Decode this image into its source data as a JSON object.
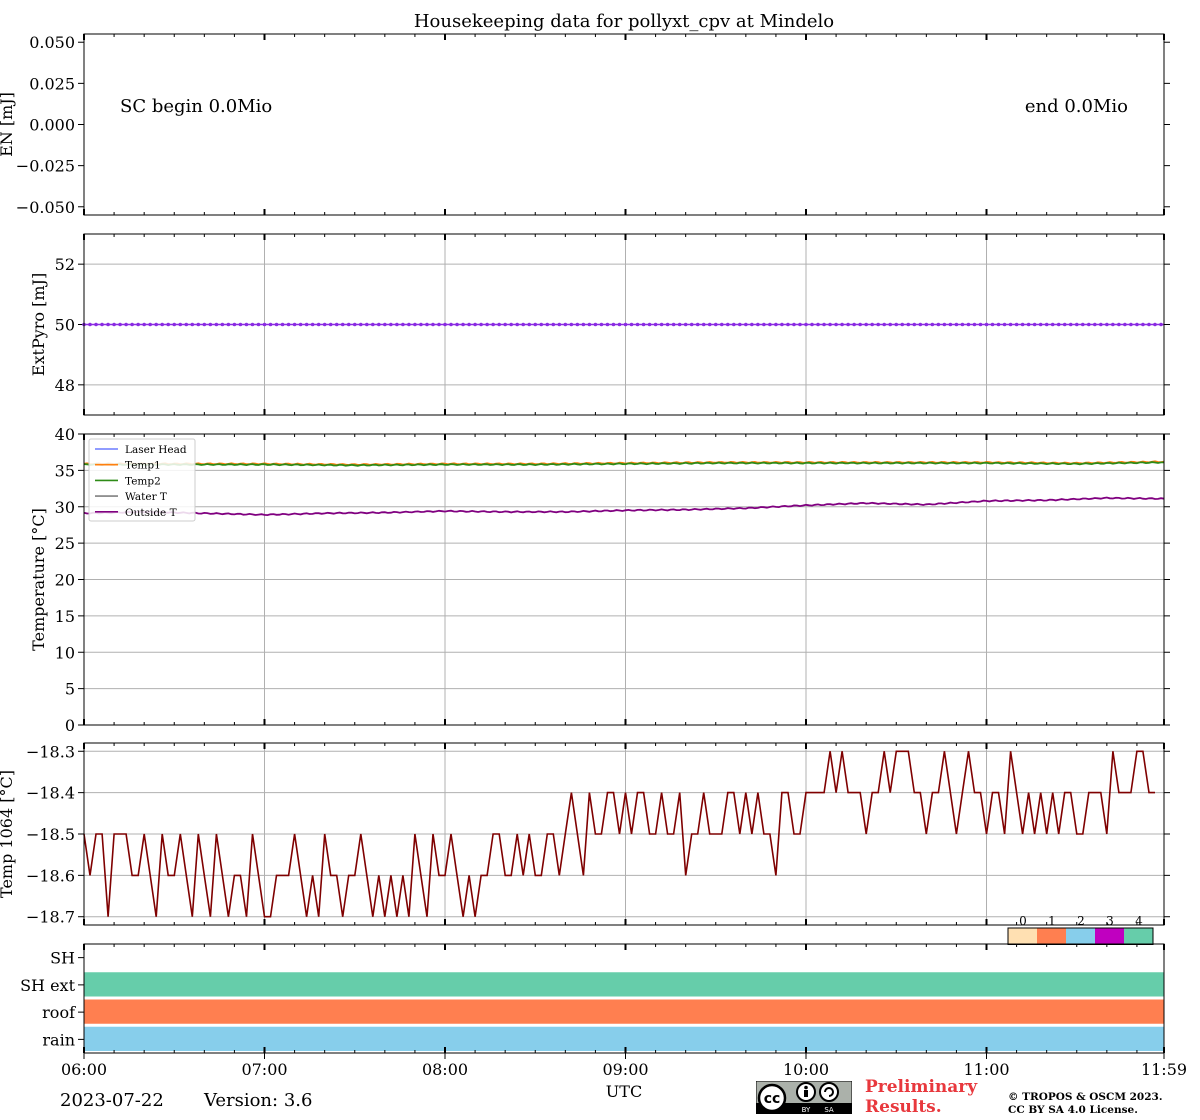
{
  "title": "Housekeeping data for pollyxt_cpv at Mindelo",
  "footer": {
    "date": "2023-07-22",
    "version": "Version: 3.6",
    "preliminary_line1": "Preliminary",
    "preliminary_line2": "Results.",
    "copyright_line1": "© TROPOS & OSCM 2023.",
    "copyright_line2": "CC BY SA 4.0 License.",
    "cc_logo_labels": [
      "cc",
      "BY",
      "SA"
    ]
  },
  "colors": {
    "laser_head": "#6b7bff",
    "temp1": "#ff7f0e",
    "temp2": "#2e8b17",
    "water_t": "#808080",
    "outside_t": "#800080",
    "extpyro": "#8a2be2",
    "temp1064": "#7f0000",
    "flag_0": "#ffe0b2",
    "flag_1": "#ff7f50",
    "flag_2": "#87ceeb",
    "flag_3": "#c000c0",
    "flag_4": "#66cdaa",
    "prelim_red": "#e8383d"
  },
  "chart_data": [
    {
      "type": "line",
      "panel": "energy",
      "ylabel": "EN [mJ]",
      "ylim": [
        -0.055,
        0.055
      ],
      "yticks": [
        "0.050",
        "0.025",
        "0.000",
        "−0.025",
        "−0.050"
      ],
      "ytick_values": [
        0.05,
        0.025,
        0.0,
        -0.025,
        -0.05
      ],
      "annotation_left": "SC begin 0.0Mio",
      "annotation_right": "end 0.0Mio",
      "series": []
    },
    {
      "type": "scatter",
      "panel": "extpyro",
      "ylabel": "ExtPyro [mJ]",
      "ylim": [
        47,
        53
      ],
      "yticks": [
        "52",
        "50",
        "48"
      ],
      "ytick_values": [
        52,
        50,
        48
      ],
      "grid": true,
      "series": [
        {
          "value": 50,
          "x_start": 0,
          "x_end": 359,
          "step": 2
        }
      ]
    },
    {
      "type": "line",
      "panel": "temperature",
      "ylabel": "Temperature [$^\\circ C$]",
      "ylim": [
        0,
        40
      ],
      "yticks": [
        "40",
        "35",
        "30",
        "25",
        "20",
        "15",
        "10",
        "5",
        "0"
      ],
      "ytick_values": [
        40,
        35,
        30,
        25,
        20,
        15,
        10,
        5,
        0
      ],
      "grid": true,
      "legend_position": "upper-left",
      "legend": [
        "Laser Head",
        "Temp1",
        "Temp2",
        "Water T",
        "Outside T"
      ],
      "series": [
        {
          "name": "Temp1",
          "x": [
            0,
            30,
            60,
            90,
            120,
            150,
            180,
            210,
            240,
            270,
            300,
            330,
            359
          ],
          "values": [
            35.9,
            35.9,
            35.9,
            35.8,
            35.9,
            35.9,
            36.0,
            36.1,
            36.1,
            36.1,
            36.1,
            36.0,
            36.2
          ]
        },
        {
          "name": "Temp2",
          "x": [
            0,
            30,
            60,
            90,
            120,
            150,
            180,
            210,
            240,
            270,
            300,
            330,
            359
          ],
          "values": [
            35.8,
            35.8,
            35.8,
            35.7,
            35.8,
            35.8,
            35.9,
            36.0,
            36.0,
            36.0,
            36.0,
            35.9,
            36.1
          ]
        },
        {
          "name": "Outside T",
          "x": [
            0,
            20,
            40,
            60,
            80,
            100,
            120,
            140,
            160,
            180,
            200,
            220,
            240,
            260,
            280,
            300,
            320,
            340,
            359
          ],
          "values": [
            29.1,
            29.3,
            29.1,
            28.9,
            29.1,
            29.2,
            29.4,
            29.3,
            29.3,
            29.5,
            29.6,
            29.8,
            30.2,
            30.5,
            30.3,
            30.8,
            30.9,
            31.2,
            31.1
          ]
        }
      ]
    },
    {
      "type": "line",
      "panel": "temp1064",
      "ylabel": "Temp 1064 [$^\\circ C$]",
      "ylim": [
        -18.72,
        -18.28
      ],
      "yticks": [
        "−18.3",
        "−18.4",
        "−18.5",
        "−18.6",
        "−18.7"
      ],
      "ytick_values": [
        -18.3,
        -18.4,
        -18.5,
        -18.6,
        -18.7
      ],
      "grid": true,
      "series": [
        {
          "name": "Temp 1064",
          "x_start": 0,
          "x_step": 2,
          "values": [
            -18.5,
            -18.6,
            -18.5,
            -18.5,
            -18.7,
            -18.5,
            -18.5,
            -18.5,
            -18.6,
            -18.6,
            -18.5,
            -18.6,
            -18.7,
            -18.5,
            -18.6,
            -18.6,
            -18.5,
            -18.6,
            -18.7,
            -18.5,
            -18.6,
            -18.7,
            -18.5,
            -18.6,
            -18.7,
            -18.6,
            -18.6,
            -18.7,
            -18.5,
            -18.6,
            -18.7,
            -18.7,
            -18.6,
            -18.6,
            -18.6,
            -18.5,
            -18.6,
            -18.7,
            -18.6,
            -18.7,
            -18.5,
            -18.6,
            -18.6,
            -18.7,
            -18.6,
            -18.6,
            -18.5,
            -18.6,
            -18.7,
            -18.6,
            -18.7,
            -18.6,
            -18.7,
            -18.6,
            -18.7,
            -18.5,
            -18.6,
            -18.7,
            -18.5,
            -18.6,
            -18.6,
            -18.5,
            -18.6,
            -18.7,
            -18.6,
            -18.7,
            -18.6,
            -18.6,
            -18.5,
            -18.5,
            -18.6,
            -18.6,
            -18.5,
            -18.6,
            -18.5,
            -18.6,
            -18.6,
            -18.5,
            -18.5,
            -18.6,
            -18.5,
            -18.4,
            -18.5,
            -18.6,
            -18.4,
            -18.5,
            -18.5,
            -18.4,
            -18.4,
            -18.5,
            -18.4,
            -18.5,
            -18.4,
            -18.4,
            -18.5,
            -18.5,
            -18.4,
            -18.5,
            -18.5,
            -18.4,
            -18.6,
            -18.5,
            -18.5,
            -18.4,
            -18.5,
            -18.5,
            -18.5,
            -18.4,
            -18.4,
            -18.5,
            -18.4,
            -18.5,
            -18.4,
            -18.5,
            -18.5,
            -18.6,
            -18.4,
            -18.4,
            -18.5,
            -18.5,
            -18.4,
            -18.4,
            -18.4,
            -18.4,
            -18.3,
            -18.4,
            -18.3,
            -18.4,
            -18.4,
            -18.4,
            -18.5,
            -18.4,
            -18.4,
            -18.3,
            -18.4,
            -18.3,
            -18.3,
            -18.3,
            -18.4,
            -18.4,
            -18.5,
            -18.4,
            -18.4,
            -18.3,
            -18.4,
            -18.5,
            -18.4,
            -18.3,
            -18.4,
            -18.4,
            -18.5,
            -18.4,
            -18.4,
            -18.5,
            -18.3,
            -18.4,
            -18.5,
            -18.4,
            -18.5,
            -18.4,
            -18.5,
            -18.4,
            -18.5,
            -18.4,
            -18.4,
            -18.5,
            -18.5,
            -18.4,
            -18.4,
            -18.4,
            -18.5,
            -18.3,
            -18.4,
            -18.4,
            -18.4,
            -18.3,
            -18.3,
            -18.4,
            -18.4
          ]
        }
      ]
    },
    {
      "type": "heatmap",
      "panel": "flags",
      "rows": [
        "SH",
        "SH ext",
        "roof",
        "rain"
      ],
      "colorbar_labels": [
        "0",
        "1",
        "2",
        "3",
        "4"
      ],
      "row_colors": [
        "#ffffff",
        "#66cdaa",
        "#ff7f50",
        "#87ceeb"
      ],
      "x_start": 0,
      "x_end": 359
    }
  ],
  "x_axis": {
    "label": "UTC",
    "range_minutes": [
      0,
      359
    ],
    "tick_minutes": [
      0,
      60,
      120,
      180,
      240,
      300,
      359
    ],
    "ticks": [
      "06:00",
      "07:00",
      "08:00",
      "09:00",
      "10:00",
      "11:00",
      "11:59"
    ]
  }
}
